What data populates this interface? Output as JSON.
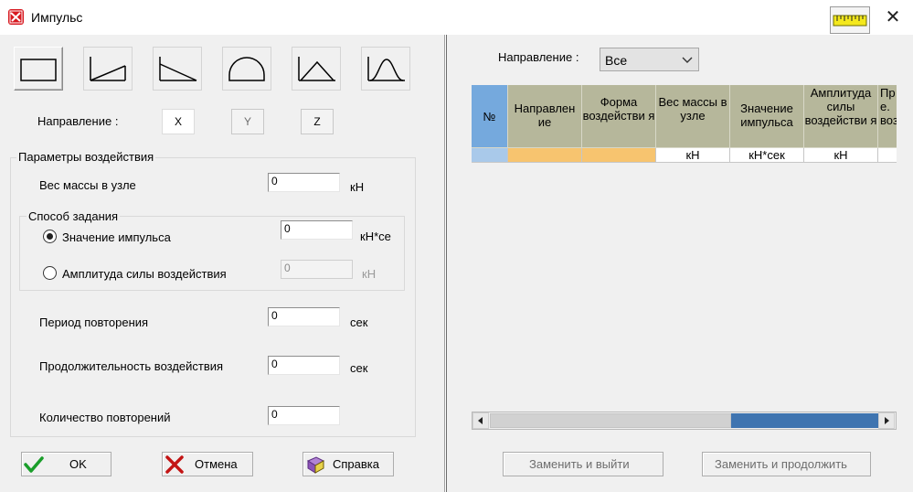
{
  "window": {
    "title": "Импульс",
    "close_glyph": "✕",
    "icons": {
      "app": "app-logo-icon",
      "ruler": "ruler-icon",
      "close": "close-icon"
    }
  },
  "shapes": [
    {
      "name": "rectangle-shape-button",
      "icon": "rectangle-pulse-icon",
      "active": true
    },
    {
      "name": "rising-ramp-shape-button",
      "icon": "rising-ramp-icon",
      "active": false
    },
    {
      "name": "falling-ramp-shape-button",
      "icon": "falling-ramp-icon",
      "active": false
    },
    {
      "name": "half-sine-shape-button",
      "icon": "half-sine-icon",
      "active": false
    },
    {
      "name": "triangle-shape-button",
      "icon": "triangle-pulse-icon",
      "active": false
    },
    {
      "name": "bell-shape-button",
      "icon": "bell-pulse-icon",
      "active": false
    }
  ],
  "direction": {
    "label": "Направление :",
    "buttons": [
      {
        "label": "X",
        "selected": true
      },
      {
        "label": "Y",
        "selected": false
      },
      {
        "label": "Z",
        "selected": false
      }
    ]
  },
  "params": {
    "group_title": "Параметры воздействия",
    "mass_label": "Вес массы в узле",
    "mass_value": "0",
    "mass_unit": "кН",
    "method": {
      "title": "Способ задания",
      "impulse_label": "Значение импульса",
      "impulse_value": "0",
      "impulse_unit": "кН*се",
      "impulse_selected": true,
      "amplitude_label": "Амплитуда силы воздействия",
      "amplitude_value": "0",
      "amplitude_unit": "кН",
      "amplitude_selected": false
    },
    "period_label": "Период повторения",
    "period_value": "0",
    "period_unit": "сек",
    "duration_label": "Продолжительность воздействия",
    "duration_value": "0",
    "duration_unit": "сек",
    "count_label": "Количество повторений",
    "count_value": "0"
  },
  "footer": {
    "ok": "OK",
    "cancel": "Отмена",
    "help": "Справка",
    "icons": {
      "ok": "checkmark-icon",
      "cancel": "red-x-icon",
      "help": "help-book-icon"
    }
  },
  "right": {
    "direction_label": "Направление :",
    "direction_value": "Все",
    "table": {
      "headers": [
        "№",
        "Направлен ие",
        "Форма воздействи я",
        "Вес массы в узле",
        "Значение импульса",
        "Амплитуда силы воздействи я",
        "Пр е. воз"
      ],
      "units": [
        "",
        "",
        "",
        "кН",
        "кН*сек",
        "кН",
        ""
      ]
    },
    "replace_exit": "Заменить и выйти",
    "replace_continue": "Заменить и продолжить",
    "scrollbar": {
      "position": 0.0
    }
  },
  "colors": {
    "header_bg": "#b6b79b",
    "number_header_bg": "#75a9dd",
    "orange_cell": "#f7c46f",
    "scroll_track": "#3f74b0"
  }
}
